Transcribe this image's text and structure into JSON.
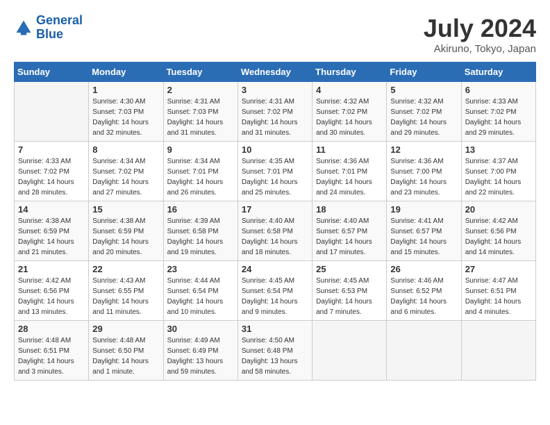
{
  "logo": {
    "line1": "General",
    "line2": "Blue"
  },
  "title": "July 2024",
  "subtitle": "Akiruno, Tokyo, Japan",
  "days_of_week": [
    "Sunday",
    "Monday",
    "Tuesday",
    "Wednesday",
    "Thursday",
    "Friday",
    "Saturday"
  ],
  "weeks": [
    [
      {
        "day": "",
        "sunrise": "",
        "sunset": "",
        "daylight": ""
      },
      {
        "day": "1",
        "sunrise": "Sunrise: 4:30 AM",
        "sunset": "Sunset: 7:03 PM",
        "daylight": "Daylight: 14 hours and 32 minutes."
      },
      {
        "day": "2",
        "sunrise": "Sunrise: 4:31 AM",
        "sunset": "Sunset: 7:03 PM",
        "daylight": "Daylight: 14 hours and 31 minutes."
      },
      {
        "day": "3",
        "sunrise": "Sunrise: 4:31 AM",
        "sunset": "Sunset: 7:02 PM",
        "daylight": "Daylight: 14 hours and 31 minutes."
      },
      {
        "day": "4",
        "sunrise": "Sunrise: 4:32 AM",
        "sunset": "Sunset: 7:02 PM",
        "daylight": "Daylight: 14 hours and 30 minutes."
      },
      {
        "day": "5",
        "sunrise": "Sunrise: 4:32 AM",
        "sunset": "Sunset: 7:02 PM",
        "daylight": "Daylight: 14 hours and 29 minutes."
      },
      {
        "day": "6",
        "sunrise": "Sunrise: 4:33 AM",
        "sunset": "Sunset: 7:02 PM",
        "daylight": "Daylight: 14 hours and 29 minutes."
      }
    ],
    [
      {
        "day": "7",
        "sunrise": "Sunrise: 4:33 AM",
        "sunset": "Sunset: 7:02 PM",
        "daylight": "Daylight: 14 hours and 28 minutes."
      },
      {
        "day": "8",
        "sunrise": "Sunrise: 4:34 AM",
        "sunset": "Sunset: 7:02 PM",
        "daylight": "Daylight: 14 hours and 27 minutes."
      },
      {
        "day": "9",
        "sunrise": "Sunrise: 4:34 AM",
        "sunset": "Sunset: 7:01 PM",
        "daylight": "Daylight: 14 hours and 26 minutes."
      },
      {
        "day": "10",
        "sunrise": "Sunrise: 4:35 AM",
        "sunset": "Sunset: 7:01 PM",
        "daylight": "Daylight: 14 hours and 25 minutes."
      },
      {
        "day": "11",
        "sunrise": "Sunrise: 4:36 AM",
        "sunset": "Sunset: 7:01 PM",
        "daylight": "Daylight: 14 hours and 24 minutes."
      },
      {
        "day": "12",
        "sunrise": "Sunrise: 4:36 AM",
        "sunset": "Sunset: 7:00 PM",
        "daylight": "Daylight: 14 hours and 23 minutes."
      },
      {
        "day": "13",
        "sunrise": "Sunrise: 4:37 AM",
        "sunset": "Sunset: 7:00 PM",
        "daylight": "Daylight: 14 hours and 22 minutes."
      }
    ],
    [
      {
        "day": "14",
        "sunrise": "Sunrise: 4:38 AM",
        "sunset": "Sunset: 6:59 PM",
        "daylight": "Daylight: 14 hours and 21 minutes."
      },
      {
        "day": "15",
        "sunrise": "Sunrise: 4:38 AM",
        "sunset": "Sunset: 6:59 PM",
        "daylight": "Daylight: 14 hours and 20 minutes."
      },
      {
        "day": "16",
        "sunrise": "Sunrise: 4:39 AM",
        "sunset": "Sunset: 6:58 PM",
        "daylight": "Daylight: 14 hours and 19 minutes."
      },
      {
        "day": "17",
        "sunrise": "Sunrise: 4:40 AM",
        "sunset": "Sunset: 6:58 PM",
        "daylight": "Daylight: 14 hours and 18 minutes."
      },
      {
        "day": "18",
        "sunrise": "Sunrise: 4:40 AM",
        "sunset": "Sunset: 6:57 PM",
        "daylight": "Daylight: 14 hours and 17 minutes."
      },
      {
        "day": "19",
        "sunrise": "Sunrise: 4:41 AM",
        "sunset": "Sunset: 6:57 PM",
        "daylight": "Daylight: 14 hours and 15 minutes."
      },
      {
        "day": "20",
        "sunrise": "Sunrise: 4:42 AM",
        "sunset": "Sunset: 6:56 PM",
        "daylight": "Daylight: 14 hours and 14 minutes."
      }
    ],
    [
      {
        "day": "21",
        "sunrise": "Sunrise: 4:42 AM",
        "sunset": "Sunset: 6:56 PM",
        "daylight": "Daylight: 14 hours and 13 minutes."
      },
      {
        "day": "22",
        "sunrise": "Sunrise: 4:43 AM",
        "sunset": "Sunset: 6:55 PM",
        "daylight": "Daylight: 14 hours and 11 minutes."
      },
      {
        "day": "23",
        "sunrise": "Sunrise: 4:44 AM",
        "sunset": "Sunset: 6:54 PM",
        "daylight": "Daylight: 14 hours and 10 minutes."
      },
      {
        "day": "24",
        "sunrise": "Sunrise: 4:45 AM",
        "sunset": "Sunset: 6:54 PM",
        "daylight": "Daylight: 14 hours and 9 minutes."
      },
      {
        "day": "25",
        "sunrise": "Sunrise: 4:45 AM",
        "sunset": "Sunset: 6:53 PM",
        "daylight": "Daylight: 14 hours and 7 minutes."
      },
      {
        "day": "26",
        "sunrise": "Sunrise: 4:46 AM",
        "sunset": "Sunset: 6:52 PM",
        "daylight": "Daylight: 14 hours and 6 minutes."
      },
      {
        "day": "27",
        "sunrise": "Sunrise: 4:47 AM",
        "sunset": "Sunset: 6:51 PM",
        "daylight": "Daylight: 14 hours and 4 minutes."
      }
    ],
    [
      {
        "day": "28",
        "sunrise": "Sunrise: 4:48 AM",
        "sunset": "Sunset: 6:51 PM",
        "daylight": "Daylight: 14 hours and 3 minutes."
      },
      {
        "day": "29",
        "sunrise": "Sunrise: 4:48 AM",
        "sunset": "Sunset: 6:50 PM",
        "daylight": "Daylight: 14 hours and 1 minute."
      },
      {
        "day": "30",
        "sunrise": "Sunrise: 4:49 AM",
        "sunset": "Sunset: 6:49 PM",
        "daylight": "Daylight: 13 hours and 59 minutes."
      },
      {
        "day": "31",
        "sunrise": "Sunrise: 4:50 AM",
        "sunset": "Sunset: 6:48 PM",
        "daylight": "Daylight: 13 hours and 58 minutes."
      },
      {
        "day": "",
        "sunrise": "",
        "sunset": "",
        "daylight": ""
      },
      {
        "day": "",
        "sunrise": "",
        "sunset": "",
        "daylight": ""
      },
      {
        "day": "",
        "sunrise": "",
        "sunset": "",
        "daylight": ""
      }
    ]
  ]
}
